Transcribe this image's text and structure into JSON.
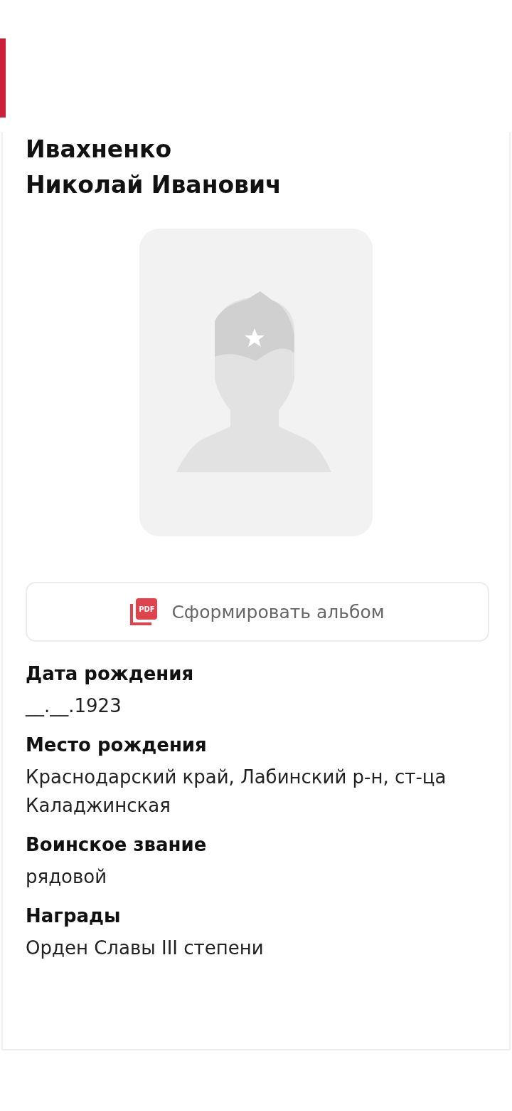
{
  "name": "Ивахненко Николай Иванович",
  "album_button": {
    "icon_text": "PDF",
    "label": "Сформировать альбом"
  },
  "fields": [
    {
      "label": "Дата рождения",
      "value": "__.__.1923"
    },
    {
      "label": "Место рождения",
      "value": "Краснодарский край, Лабинский р-н, ст-ца Каладжинская"
    },
    {
      "label": "Воинское звание",
      "value": "рядовой"
    },
    {
      "label": "Награды",
      "value": "Орден Славы III степени"
    }
  ]
}
